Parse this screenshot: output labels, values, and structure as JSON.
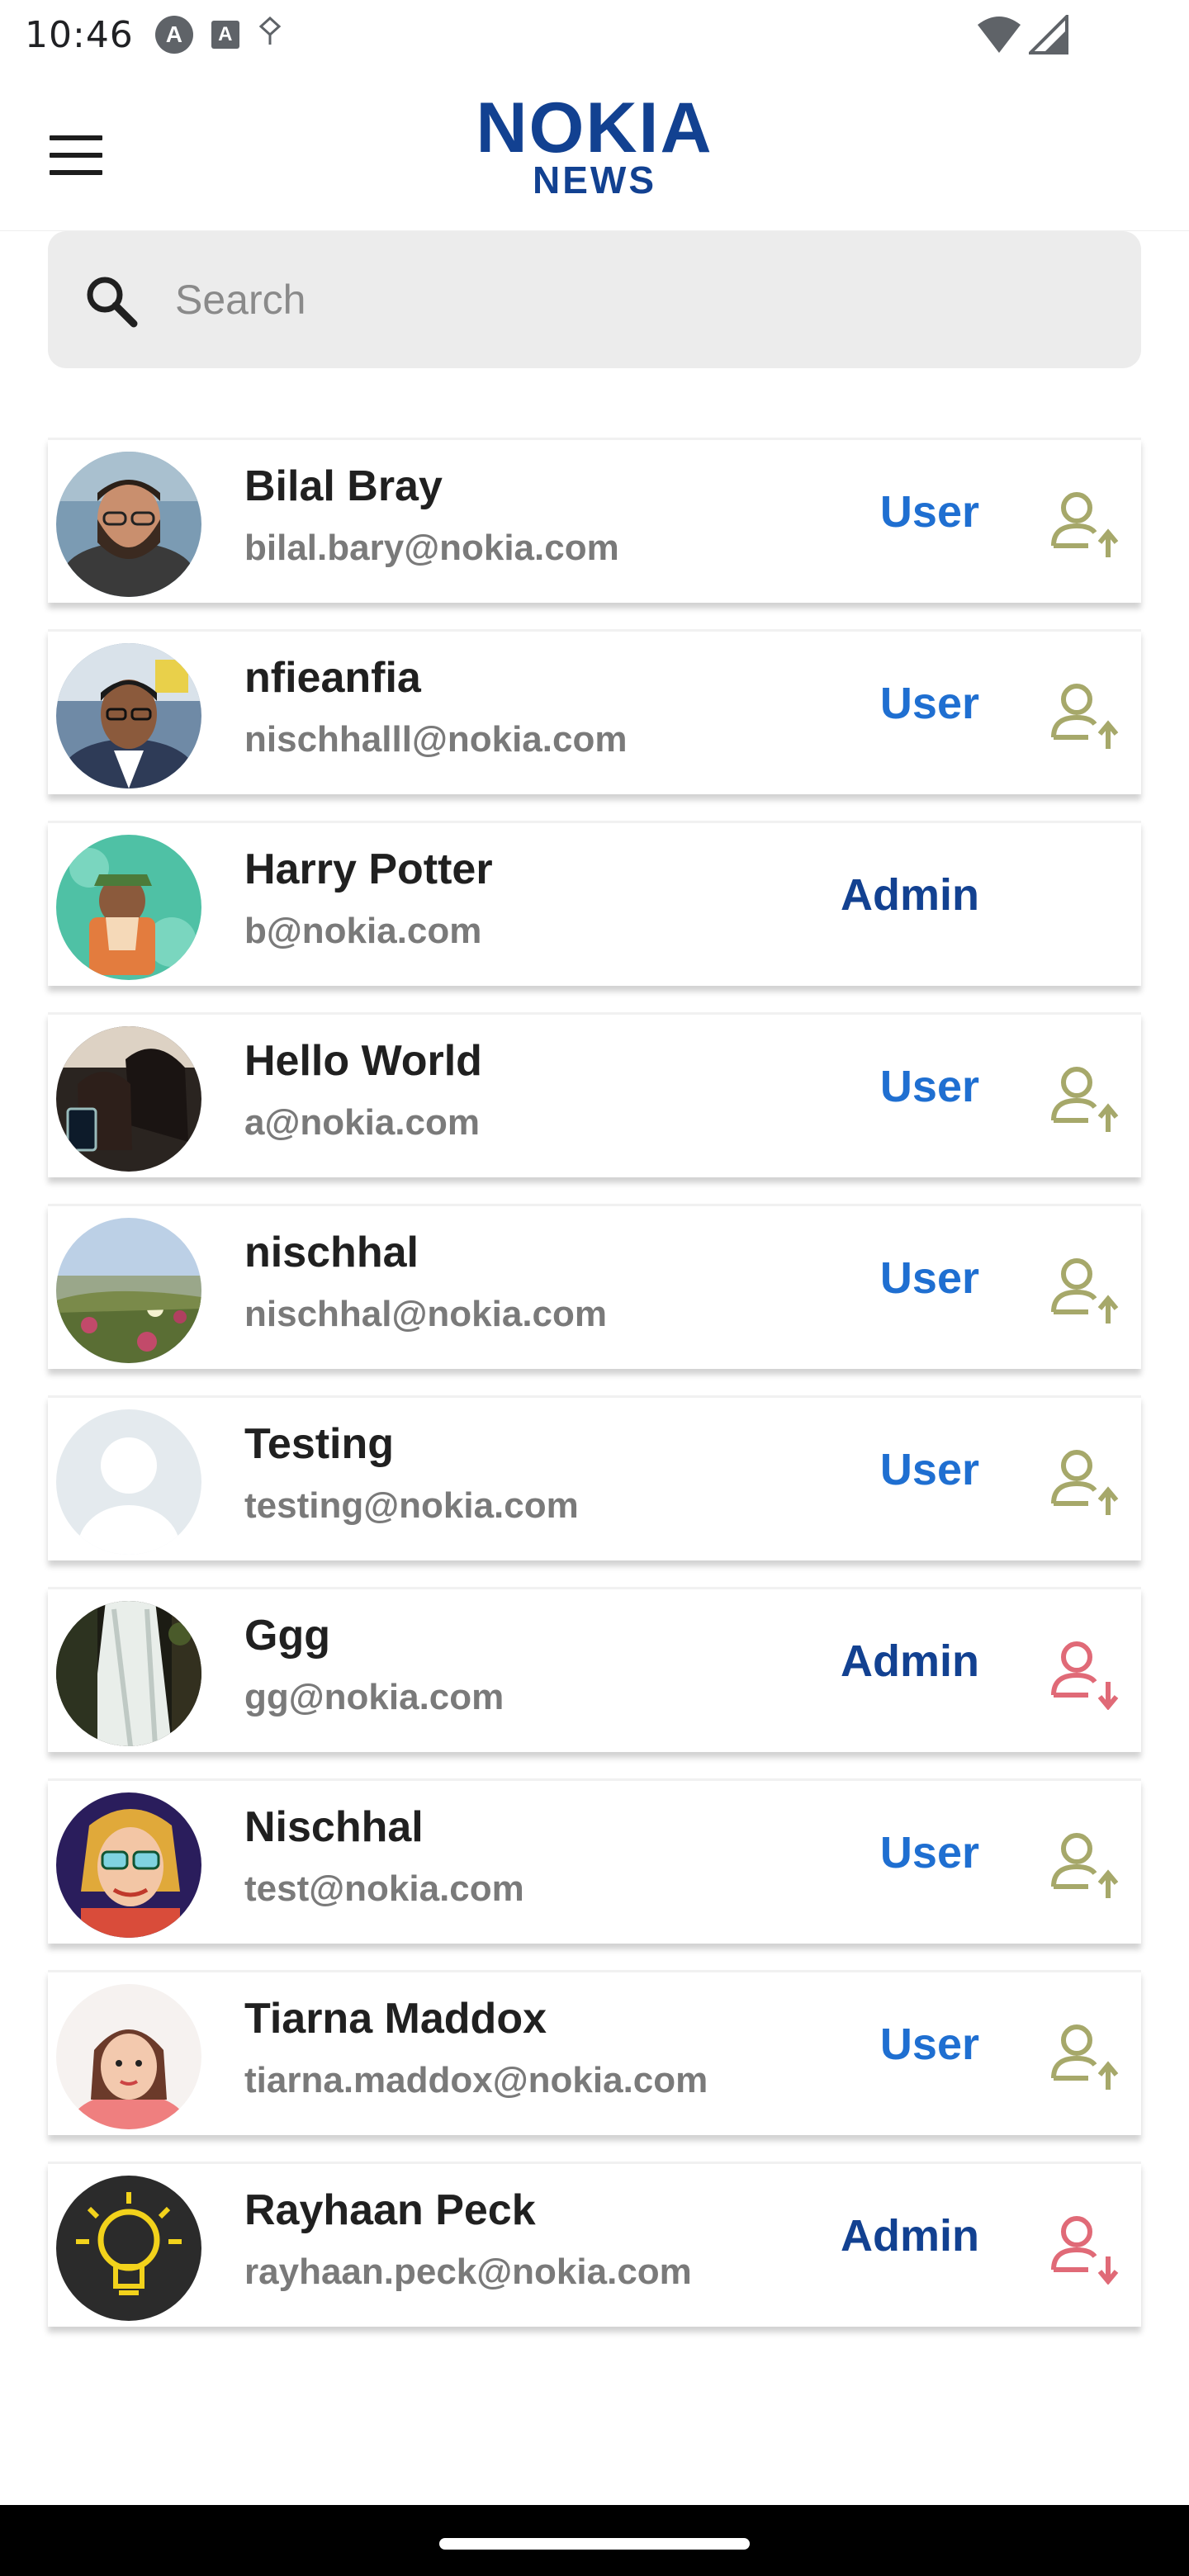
{
  "status_bar": {
    "time": "10:46",
    "left_icons": [
      "A",
      "A",
      "✧"
    ]
  },
  "header": {
    "logo_top": "NOKIA",
    "logo_bottom": "NEWS",
    "brand_color": "#124191",
    "menu_icon": "hamburger-menu-icon"
  },
  "search": {
    "placeholder": "Search",
    "value": ""
  },
  "users": [
    {
      "name": "Bilal Bray",
      "email": "bilal.bary@nokia.com",
      "role": "User",
      "action": "promote",
      "avatar": "bearded-man"
    },
    {
      "name": "nfieanfia",
      "email": "nischhalll@nokia.com",
      "role": "User",
      "action": "promote",
      "avatar": "man-glasses"
    },
    {
      "name": "Harry Potter",
      "email": "b@nokia.com",
      "role": "Admin",
      "action": "none",
      "avatar": "illustration-teal"
    },
    {
      "name": "Hello World",
      "email": "a@nokia.com",
      "role": "User",
      "action": "promote",
      "avatar": "women-tablet"
    },
    {
      "name": "nischhal",
      "email": "nischhal@nokia.com",
      "role": "User",
      "action": "promote",
      "avatar": "coastal-landscape"
    },
    {
      "name": "Testing",
      "email": "testing@nokia.com",
      "role": "User",
      "action": "promote",
      "avatar": "placeholder-person"
    },
    {
      "name": "Ggg",
      "email": "gg@nokia.com",
      "role": "Admin",
      "action": "demote",
      "avatar": "waterfall"
    },
    {
      "name": "Nischhal",
      "email": "test@nokia.com",
      "role": "User",
      "action": "promote",
      "avatar": "cartoon-woman-glasses"
    },
    {
      "name": "Tiarna Maddox",
      "email": "tiarna.maddox@nokia.com",
      "role": "User",
      "action": "promote",
      "avatar": "cartoon-woman"
    },
    {
      "name": "Rayhaan Peck",
      "email": "rayhaan.peck@nokia.com",
      "role": "Admin",
      "action": "demote",
      "avatar": "lightbulb"
    }
  ],
  "colors": {
    "user_role": "#1f6fd1",
    "admin_role": "#124191",
    "promote_icon": "#a6a86a",
    "demote_icon": "#e06a77"
  }
}
